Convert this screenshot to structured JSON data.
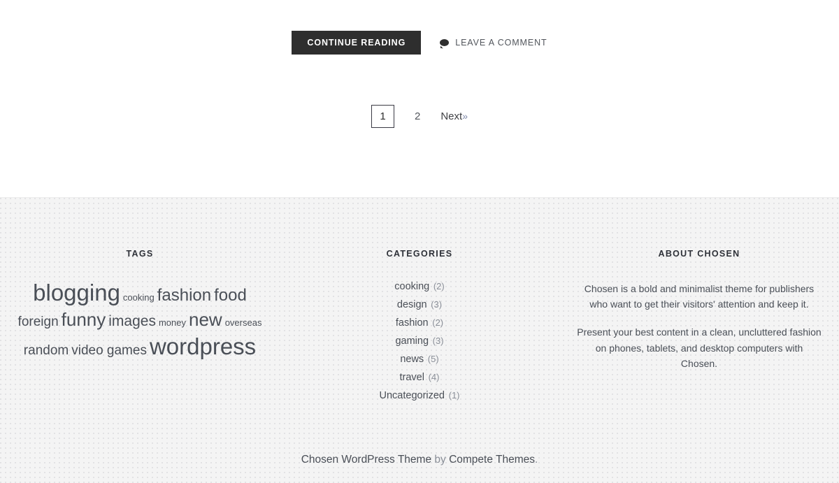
{
  "post": {
    "cut_off_text": "",
    "continue_reading_label": "Continue Reading",
    "comment_link_label": "Leave a Comment",
    "comment_icon": "speech-bubble-icon"
  },
  "pagination": {
    "current_page": "1",
    "page_2": "2",
    "next_label": "Next",
    "next_chevron": "»"
  },
  "footer": {
    "tags_widget": {
      "title": "Tags",
      "rows": [
        [
          {
            "label": "blogging",
            "size": 33
          },
          {
            "label": "cooking",
            "size": 13
          },
          {
            "label": "fashion",
            "size": 24
          },
          {
            "label": "food",
            "size": 24
          }
        ],
        [
          {
            "label": "foreign",
            "size": 19
          },
          {
            "label": "funny",
            "size": 26
          },
          {
            "label": "images",
            "size": 21
          },
          {
            "label": "money",
            "size": 13
          },
          {
            "label": "new",
            "size": 26
          },
          {
            "label": "overseas",
            "size": 13
          }
        ],
        [
          {
            "label": "random",
            "size": 19
          },
          {
            "label": "video games",
            "size": 19
          },
          {
            "label": "wordpress",
            "size": 33
          }
        ]
      ]
    },
    "categories_widget": {
      "title": "Categories",
      "items": [
        {
          "name": "cooking",
          "count": "(2)"
        },
        {
          "name": "design",
          "count": "(3)"
        },
        {
          "name": "fashion",
          "count": "(2)"
        },
        {
          "name": "gaming",
          "count": "(3)"
        },
        {
          "name": "news",
          "count": "(5)"
        },
        {
          "name": "travel",
          "count": "(4)"
        },
        {
          "name": "Uncategorized",
          "count": "(1)"
        }
      ]
    },
    "about_widget": {
      "title": "About Chosen",
      "paragraph_1": "Chosen is a bold and minimalist theme for publishers who want to get their visitors' attention and keep it.",
      "paragraph_2": "Present your best content in a clean, uncluttered fashion on phones, tablets, and desktop computers with Chosen."
    },
    "credit": {
      "theme_link": "Chosen WordPress Theme",
      "by_text": " by ",
      "author_link": "Compete Themes",
      "period": "."
    }
  },
  "colors": {
    "button_bg": "#2e2e2e",
    "button_text": "#ffffff",
    "body_text": "#4a4f57",
    "muted_text": "#8a8f98",
    "footer_bg": "#f4f4f4",
    "page_bg": "#ffffff"
  }
}
